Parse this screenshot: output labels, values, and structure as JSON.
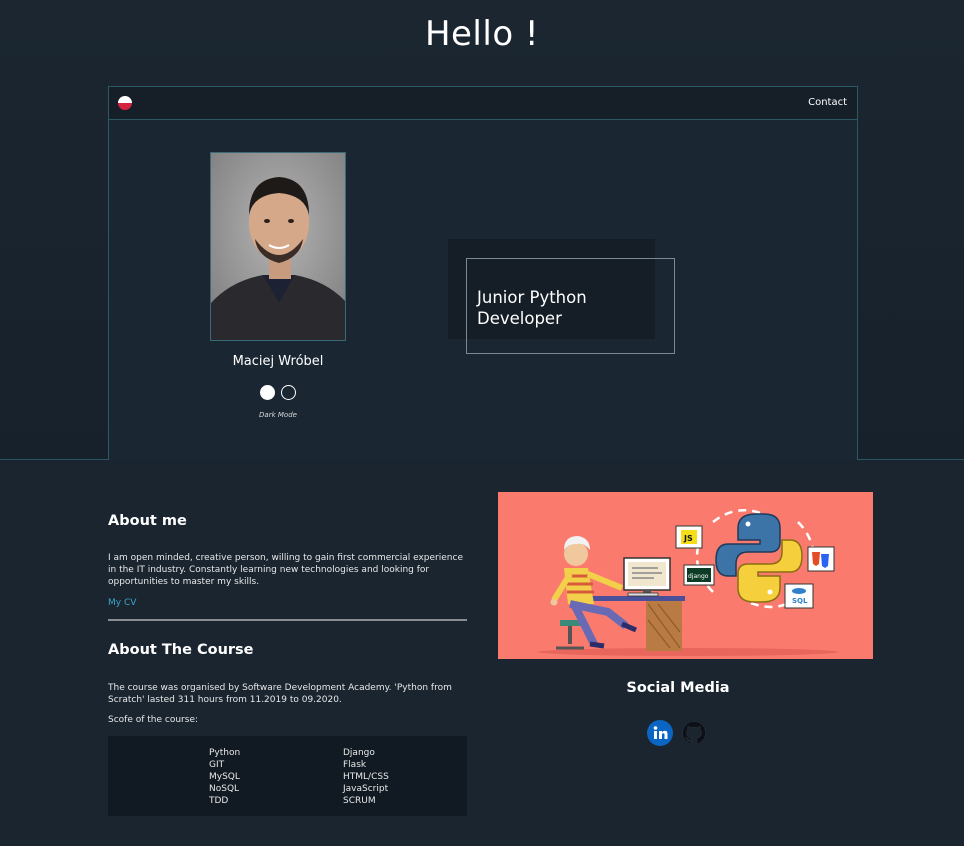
{
  "header": {
    "title": "Hello !"
  },
  "nav": {
    "flag_icon": "poland-flag-icon",
    "contact_label": "Contact"
  },
  "profile": {
    "name": "Maciej Wróbel",
    "mode_label": "Dark Mode",
    "role": "Junior Python Developer"
  },
  "about": {
    "title": "About me",
    "text": "I am open minded, creative person, willing to gain first commercial experience in the IT industry. Constantly learning new technologies and looking for opportunities to master my skills.",
    "cv_link": "My CV"
  },
  "course": {
    "title": "About The Course",
    "text": "The course was organised by Software Development Academy. 'Python from Scratch' lasted 311 hours from 11.2019 to 09.2020.",
    "scope_label": "Scofe of the course:",
    "skills_left": [
      "Python",
      "GIT",
      "MySQL",
      "NoSQL",
      "TDD"
    ],
    "skills_right": [
      "Django",
      "Flask",
      "HTML/CSS",
      "JavaScript",
      "SCRUM"
    ]
  },
  "illustration": {
    "labels": [
      "JS",
      "django",
      "SQL"
    ]
  },
  "social": {
    "title": "Social Media",
    "icons": [
      "linkedin-icon",
      "github-icon"
    ]
  },
  "colors": {
    "background": "#1a2530",
    "accent_link": "#3aa7c9",
    "illustration_bg": "#fa7b6e",
    "linkedin": "#0a66c2"
  }
}
